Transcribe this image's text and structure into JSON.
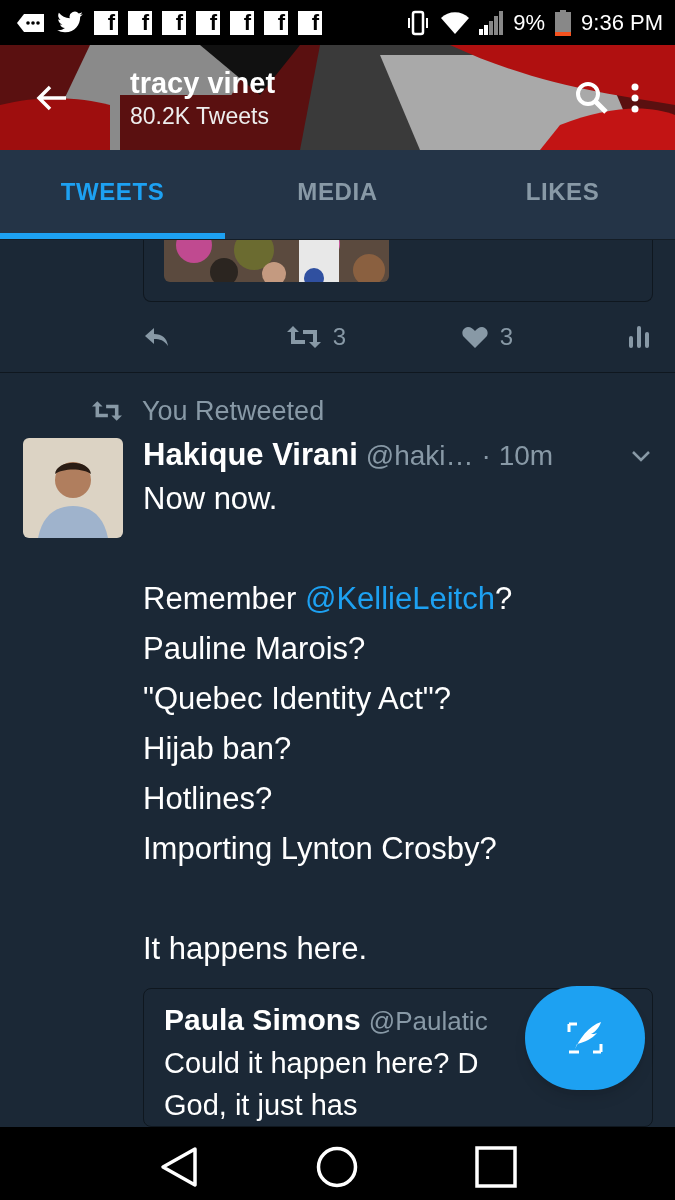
{
  "status_bar": {
    "notifications": [
      {
        "kind": "message"
      },
      {
        "kind": "bird"
      },
      {
        "kind": "app",
        "glyph": "f"
      },
      {
        "kind": "app",
        "glyph": "f"
      },
      {
        "kind": "app",
        "glyph": "f"
      },
      {
        "kind": "app",
        "glyph": "f"
      },
      {
        "kind": "app",
        "glyph": "f"
      },
      {
        "kind": "app",
        "glyph": "f"
      },
      {
        "kind": "app",
        "glyph": "f"
      }
    ],
    "battery": "9%",
    "time": "9:36 PM"
  },
  "header": {
    "title": "tracy vinet",
    "subtitle": "80.2K Tweets"
  },
  "tabs": [
    {
      "label": "TWEETS",
      "selected": true
    },
    {
      "label": "MEDIA",
      "selected": false
    },
    {
      "label": "LIKES",
      "selected": false
    }
  ],
  "previous_tweet": {
    "actions": [
      {
        "kind": "reply"
      },
      {
        "kind": "retweet",
        "count": "3"
      },
      {
        "kind": "like",
        "count": "3"
      },
      {
        "kind": "analytics"
      }
    ]
  },
  "tweet": {
    "context": "You Retweeted",
    "author": "Hakique Virani",
    "handle": "@haki…",
    "time": "· 10m",
    "lines": [
      {
        "kind": "text",
        "parts": [
          {
            "text": "Now now."
          }
        ]
      },
      {
        "kind": "gap"
      },
      {
        "kind": "text",
        "parts": [
          {
            "text": "Remember "
          },
          {
            "text": "@KellieLeitch",
            "kind": "mention"
          },
          {
            "text": "?"
          }
        ]
      },
      {
        "kind": "text",
        "parts": [
          {
            "text": "Pauline Marois?"
          }
        ]
      },
      {
        "kind": "text",
        "parts": [
          {
            "text": "\"Quebec Identity Act\"?"
          }
        ]
      },
      {
        "kind": "text",
        "parts": [
          {
            "text": "Hijab ban?"
          }
        ]
      },
      {
        "kind": "text",
        "parts": [
          {
            "text": "Hotlines?"
          }
        ]
      },
      {
        "kind": "text",
        "parts": [
          {
            "text": "Importing Lynton Crosby?"
          }
        ]
      },
      {
        "kind": "gap"
      },
      {
        "kind": "text",
        "parts": [
          {
            "text": "It happens here."
          }
        ]
      }
    ],
    "quote": {
      "author": "Paula Simons",
      "handle": "@Paulatic",
      "lines": [
        "Could it happen here? D",
        "God, it just has"
      ]
    }
  },
  "fab": {
    "kind": "compose"
  }
}
